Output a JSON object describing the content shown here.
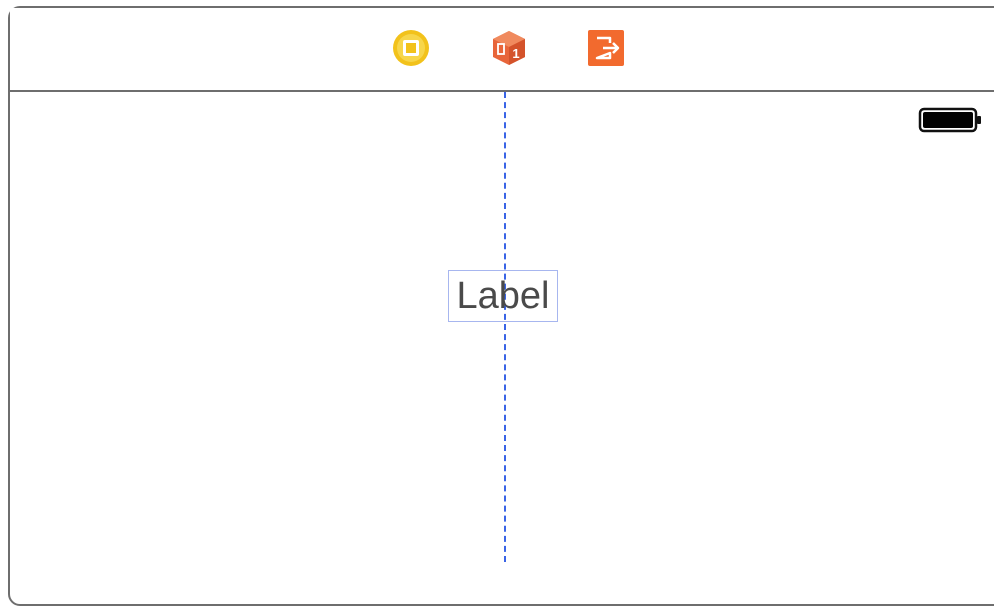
{
  "dock": {
    "icons": [
      {
        "name": "view-controller-icon",
        "color": "#f2c21b"
      },
      {
        "name": "first-responder-icon",
        "color": "#e8653a"
      },
      {
        "name": "exit-icon",
        "color": "#f26a2e"
      }
    ]
  },
  "canvas": {
    "label_text": "Label",
    "guide_color": "#3a64e6",
    "battery_icon": "battery-icon"
  }
}
